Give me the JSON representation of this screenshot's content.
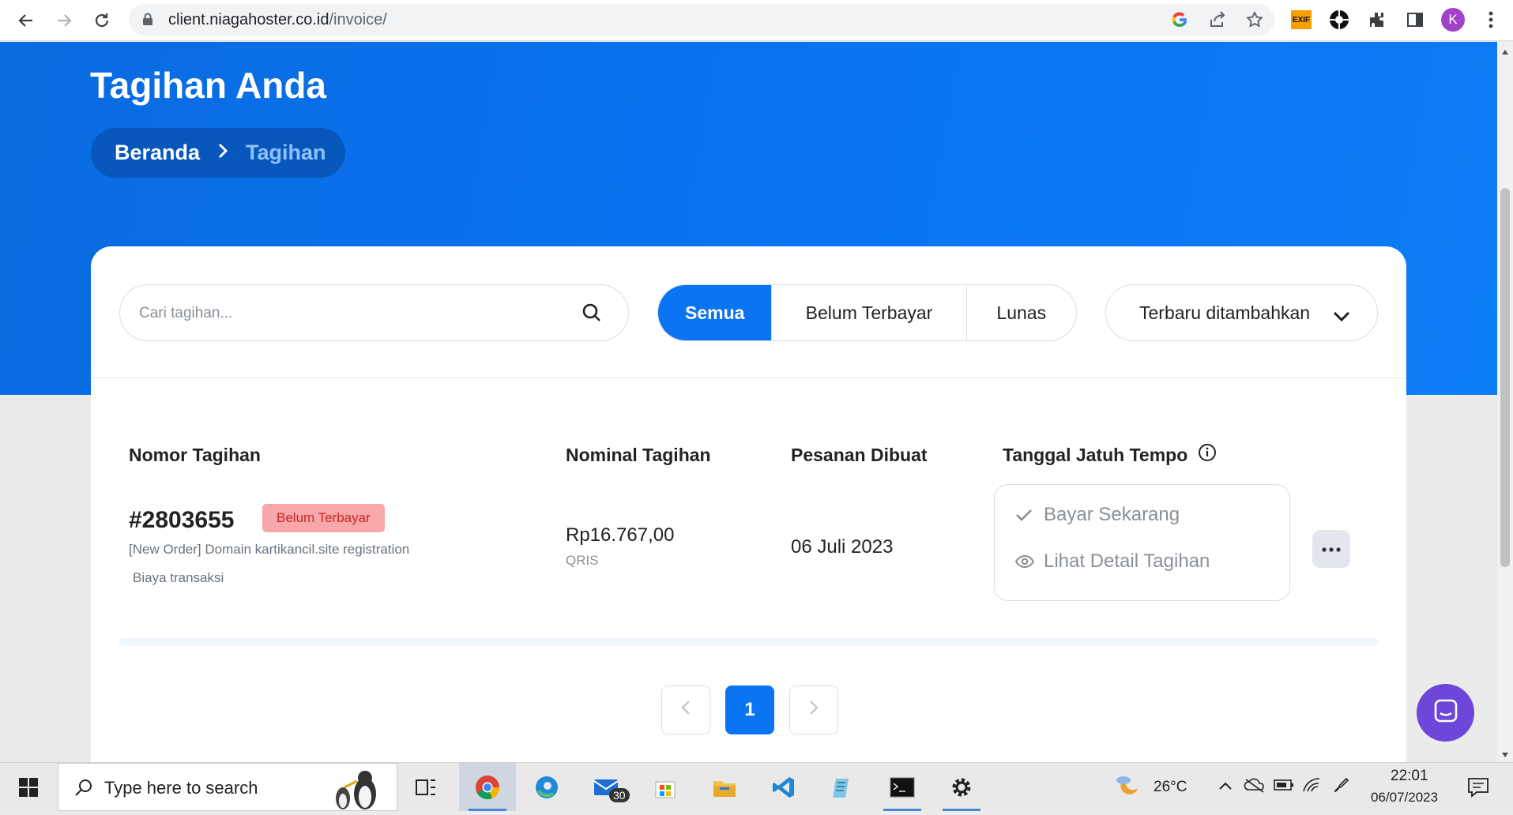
{
  "browser": {
    "url_host": "client.niagahoster.co.id",
    "url_path": "/invoice/",
    "profile_initial": "K",
    "exif_ext_label": "EXIF"
  },
  "page": {
    "title": "Tagihan Anda",
    "breadcrumb": {
      "home": "Beranda",
      "current": "Tagihan"
    }
  },
  "toolbar": {
    "search_placeholder": "Cari tagihan...",
    "filters": [
      {
        "label": "Semua",
        "active": true
      },
      {
        "label": "Belum Terbayar",
        "active": false
      },
      {
        "label": "Lunas",
        "active": false
      }
    ],
    "sort_label": "Terbaru ditambahkan"
  },
  "table": {
    "headers": {
      "invoice_no": "Nomor Tagihan",
      "amount": "Nominal Tagihan",
      "created": "Pesanan Dibuat",
      "due": "Tanggal Jatuh Tempo"
    },
    "rows": [
      {
        "invoice_no": "#2803655",
        "status": "Belum Terbayar",
        "description": "[New Order] Domain kartikancil.site registration",
        "fee_note": "Biaya transaksi",
        "amount": "Rp16.767,00",
        "method": "QRIS",
        "created": "06 Juli 2023",
        "actions": {
          "pay": "Bayar Sekarang",
          "detail": "Lihat Detail Tagihan"
        }
      }
    ]
  },
  "pagination": {
    "current_page": "1"
  },
  "taskbar": {
    "search_placeholder": "Type here to search",
    "mail_badge": "30",
    "weather": "26°C",
    "time": "22:01",
    "date": "06/07/2023"
  },
  "colors": {
    "brand_blue": "#0a74f2",
    "breadcrumb_bg": "#0757bd",
    "badge_bg": "#f8a8a8",
    "badge_text": "#c62828",
    "chat_purple": "#6c47d9"
  }
}
